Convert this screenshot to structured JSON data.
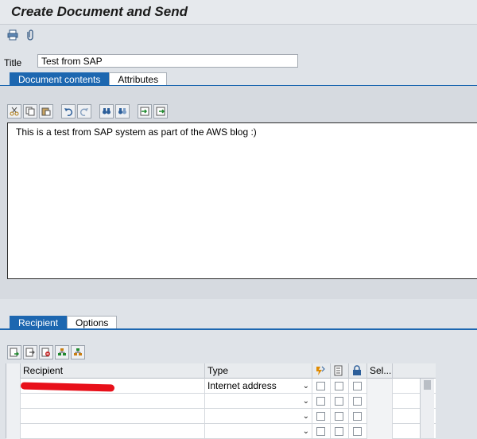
{
  "window": {
    "title": "Create Document and Send"
  },
  "app_toolbar": {
    "icons": [
      "print-icon",
      "attachment-icon"
    ]
  },
  "title_field": {
    "label": "Title",
    "value": "Test from SAP"
  },
  "doc_tabs": [
    {
      "label": "Document contents",
      "active": true
    },
    {
      "label": "Attributes",
      "active": false
    }
  ],
  "editor": {
    "toolbar_icons": [
      "cut-icon",
      "copy-icon",
      "paste-icon",
      "undo-icon",
      "redo-icon",
      "find-icon",
      "find-next-icon",
      "import-icon",
      "export-icon"
    ],
    "text": "This is a test from SAP system as part of the AWS blog :)"
  },
  "recipient_tabs": [
    {
      "label": "Recipient",
      "active": true
    },
    {
      "label": "Options",
      "active": false
    }
  ],
  "grid_toolbar": {
    "icons": [
      "append-row-icon",
      "insert-row-icon",
      "delete-row-icon",
      "distribution-list-icon",
      "address-book-icon"
    ]
  },
  "grid": {
    "columns": [
      "Recipient",
      "Type",
      "",
      "",
      "",
      "Sel..."
    ],
    "header_icons": [
      "express-icon",
      "copy-icon",
      "lock-icon"
    ],
    "rows": [
      {
        "recipient": "",
        "type": "Internet address"
      },
      {
        "recipient": "",
        "type": ""
      },
      {
        "recipient": "",
        "type": ""
      },
      {
        "recipient": "",
        "type": ""
      }
    ]
  },
  "colors": {
    "accent": "#1d67b0",
    "redaction": "#e8101a"
  }
}
